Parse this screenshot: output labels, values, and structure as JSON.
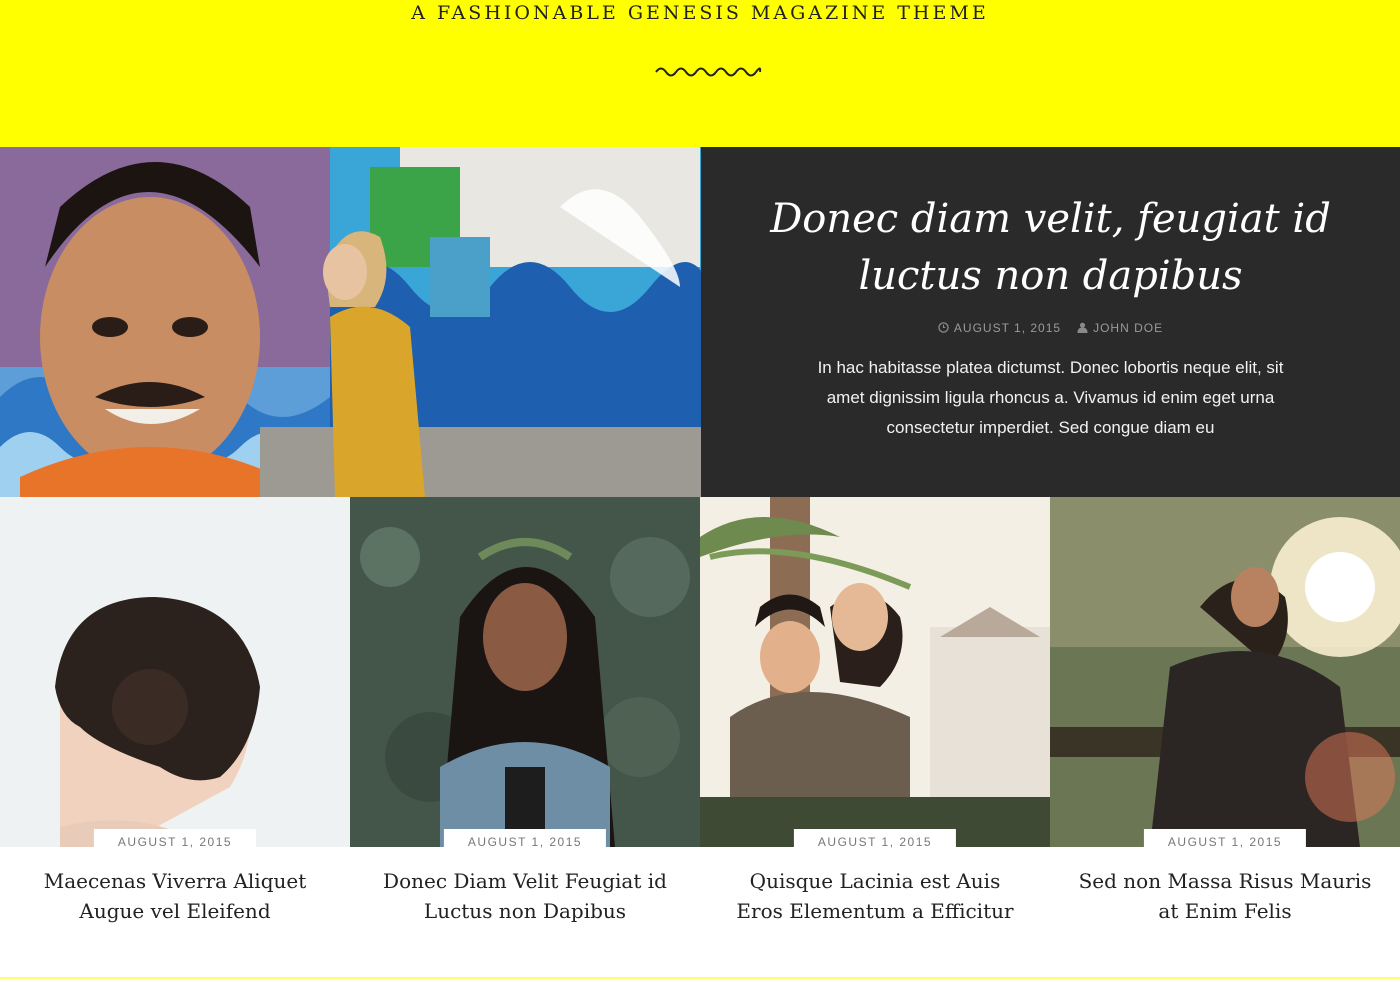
{
  "header": {
    "tagline": "A FASHIONABLE GENESIS MAGAZINE THEME",
    "background_color": "#ffff00",
    "divider_icon": "squiggle-divider-icon"
  },
  "featured": {
    "title": "Donec diam velit, feugiat id luctus non dapibus",
    "date": "AUGUST 1, 2015",
    "author": "JOHN DOE",
    "date_icon": "clock-icon",
    "author_icon": "user-icon",
    "excerpt": "In hac habitasse platea dictumst. Donec lobortis neque elit, sit amet dignissim ligula rhoncus a. Vivamus id enim eget urna consectetur imperdiet. Sed congue diam eu",
    "panel_color": "#2a2a2a"
  },
  "posts": [
    {
      "date": "AUGUST 1, 2015",
      "title": "Maecenas Viverra Aliquet Augue vel Eleifend"
    },
    {
      "date": "AUGUST 1, 2015",
      "title": "Donec Diam Velit Feugiat id Luctus non Dapibus"
    },
    {
      "date": "AUGUST 1, 2015",
      "title": "Quisque Lacinia est Auis Eros Elementum a Efficitur"
    },
    {
      "date": "AUGUST 1, 2015",
      "title": "Sed non Massa Risus Mauris at Enim Felis"
    }
  ]
}
